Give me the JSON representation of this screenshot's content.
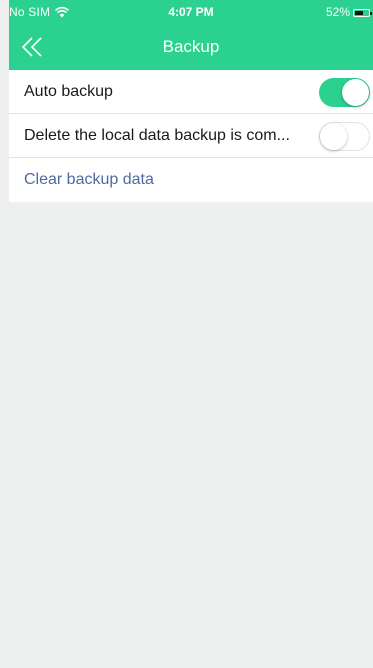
{
  "colors": {
    "accent": "#2bd18f",
    "background": "#eef0ef",
    "link": "#4e6b9f",
    "text": "#1a1a1a"
  },
  "status_bar": {
    "carrier": "No SIM",
    "wifi_icon": "wifi-icon",
    "time": "4:07 PM",
    "battery_percent": "52%",
    "battery_level": 0.52
  },
  "nav_bar": {
    "back_icon": "double-chevron-left-icon",
    "title": "Backup"
  },
  "settings": {
    "auto_backup": {
      "label": "Auto backup",
      "enabled": true
    },
    "delete_local": {
      "label": "Delete the local data backup is com...",
      "enabled": false
    },
    "clear_backup": {
      "label": "Clear backup data"
    }
  }
}
